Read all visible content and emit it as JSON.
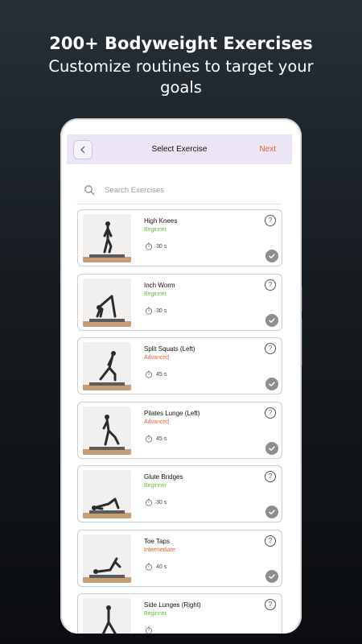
{
  "promo": {
    "title": "200+ Bodyweight Exercises",
    "subtitle": "Customize routines to target your goals"
  },
  "header": {
    "title": "Select Exercise",
    "next_label": "Next"
  },
  "search": {
    "placeholder": "Search Exercises"
  },
  "colors": {
    "beginner": "#5bbf3a",
    "advanced": "#e55c2f",
    "intermediate": "#e55c2f",
    "header_bg": "#ece5f5"
  },
  "exercises": [
    {
      "name": "High Knees",
      "level": "Beginner",
      "level_key": "beginner",
      "duration": "30 s"
    },
    {
      "name": "Inch Worm",
      "level": "Beginner",
      "level_key": "beginner",
      "duration": "30 s"
    },
    {
      "name": "Split Squats (Left)",
      "level": "Advanced",
      "level_key": "advanced",
      "duration": "45 s"
    },
    {
      "name": "Pilates Lunge (Left)",
      "level": "Advanced",
      "level_key": "advanced",
      "duration": "45 s"
    },
    {
      "name": "Glute Bridges",
      "level": "Beginner",
      "level_key": "beginner",
      "duration": "30 s"
    },
    {
      "name": "Toe Taps",
      "level": "Intermediate",
      "level_key": "intermediate",
      "duration": "40 s"
    },
    {
      "name": "Side Lunges (Right)",
      "level": "Beginner",
      "level_key": "beginner",
      "duration": ""
    }
  ]
}
